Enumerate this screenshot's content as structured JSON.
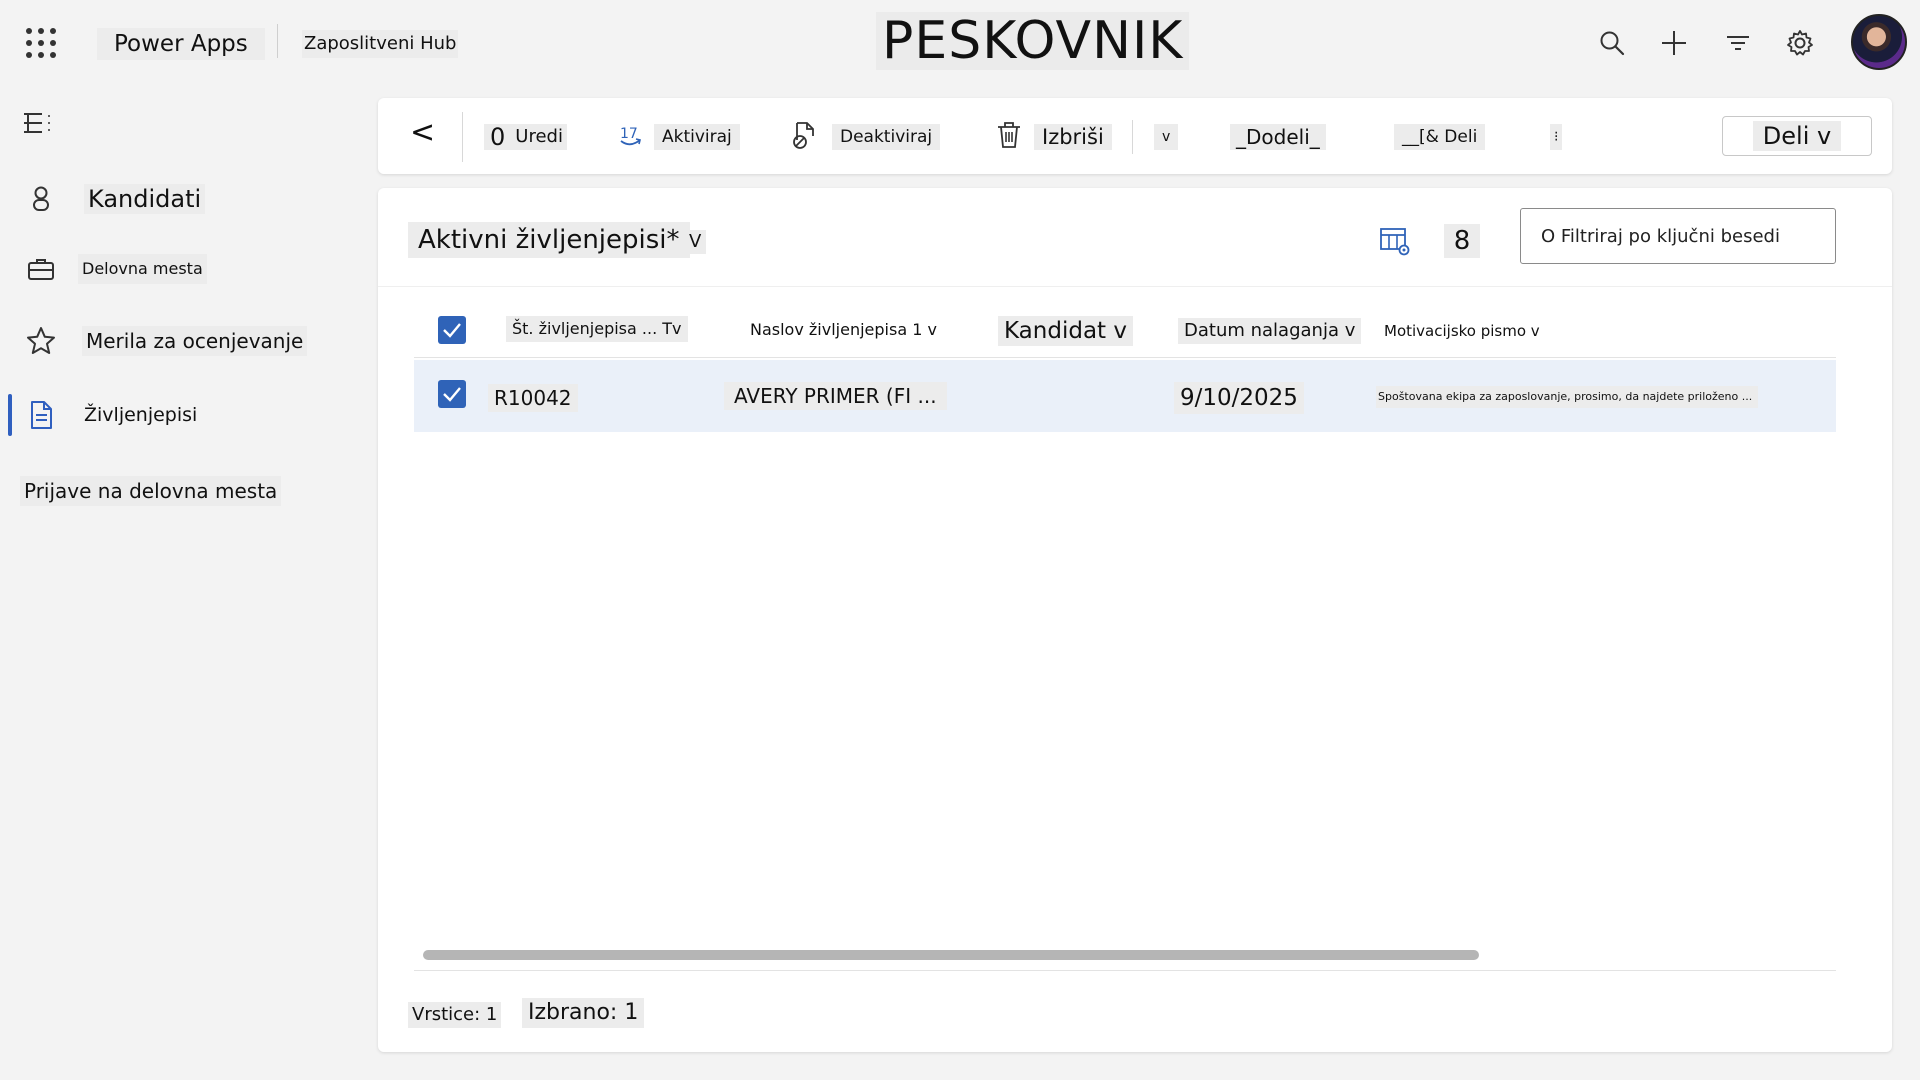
{
  "header": {
    "app_name": "Power Apps",
    "hub_name": "Zaposlitveni Hub",
    "environment": "PESKOVNIK",
    "icons": [
      "search-icon",
      "plus-icon",
      "filter-icon",
      "settings-icon"
    ]
  },
  "sidebar": {
    "items": [
      {
        "label": "Kandidati",
        "icon": "person-icon"
      },
      {
        "label": "Delovna mesta",
        "icon": "briefcase-icon"
      },
      {
        "label": "Merila za ocenjevanje",
        "icon": "star-icon"
      },
      {
        "label": "Življenjepisi",
        "icon": "document-icon",
        "active": true
      },
      {
        "label": "Prijave na delovna mesta"
      }
    ]
  },
  "commandbar": {
    "back": "<",
    "edit_num": "0",
    "edit": "Uredi",
    "activate": "Aktiviraj",
    "deactivate": "Deaktiviraj",
    "delete": "Izbriši",
    "chevron": "v",
    "assign": "_Dodeli_",
    "share_item": "__[& Deli",
    "more": "⁝",
    "share_button": "Deli v"
  },
  "view": {
    "title": "Aktivni življenjepisi*",
    "chevron": "V",
    "count": "8",
    "filter_placeholder": "O Filtriraj po ključni besedi"
  },
  "table": {
    "columns": [
      "Št. življenjepisa ... Tv",
      "Naslov življenjepisa 1 v",
      "Kandidat v",
      "Datum nalaganja v",
      "Motivacijsko pismo v"
    ],
    "rows": [
      {
        "id": "R10042",
        "title": "AVERY PRIMER (FI ...",
        "candidate": "",
        "date": "9/10/2025",
        "letter": "Spoštovana ekipa za zaposlovanje, prosimo, da najdete priloženo ..."
      }
    ]
  },
  "footer": {
    "rows": "Vrstice: 1",
    "selected": "Izbrano: 1"
  },
  "colors": {
    "accent": "#2f63b8",
    "row_selected": "#eaf0f9"
  }
}
